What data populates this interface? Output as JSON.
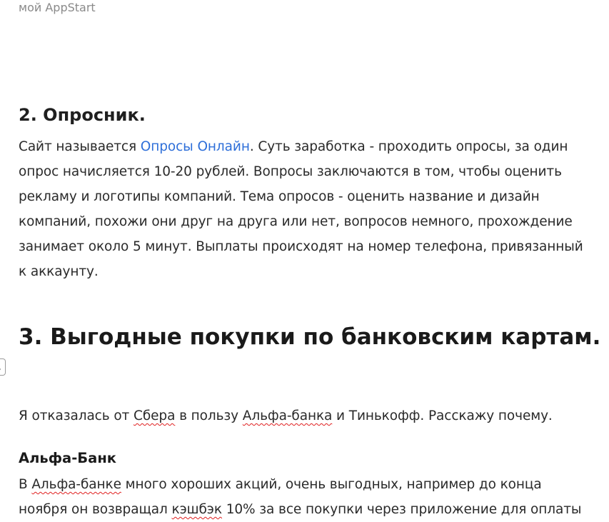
{
  "top_fragment": "мой AppStart",
  "section2": {
    "heading": "2. Опросник.",
    "link_before": "Сайт называется ",
    "link_text": "Опросы Онлайн",
    "line1_after": ". Суть заработка - проходить опросы, за один",
    "line2": "опрос начисляется 10-20 рублей. Вопросы заключаются в том, чтобы оценить",
    "line3": "рекламу и логотипы компаний. Тема опросов - оценить название и дизайн",
    "line4": "компаний, похожи они друг на друга или нет, вопросов немного, прохождение",
    "line5": "занимает около 5 минут. Выплаты происходят на номер телефона, привязанный",
    "line6": "к аккаунту."
  },
  "section3": {
    "heading": "3. Выгодные покупки по банковским картам.",
    "intro": {
      "part1": "Я отказалась от ",
      "sber": "Сбера",
      "part2": " в пользу ",
      "alfa": "Альфа-банка",
      "part3": " и Тинькофф. Расскажу почему."
    },
    "alfa_heading": "Альфа-Банк",
    "alfa_para": {
      "line1_part1": "В ",
      "line1_alfa": "Альфа-банке",
      "line1_part2": " много хороших акций, очень выгодных, например до конца",
      "line2_part1": "ноября он возвращал ",
      "line2_cashback": "кэшбэк",
      "line2_part2": " 10% за все покупки через приложение для оплаты"
    }
  },
  "colors": {
    "link": "#2e6fd9",
    "spellcheck": "#e02020",
    "text": "#2a2a2a"
  }
}
